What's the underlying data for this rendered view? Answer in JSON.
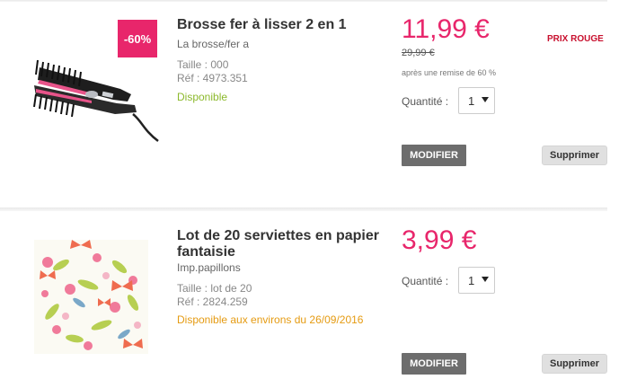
{
  "items": [
    {
      "badge": "-60%",
      "title": "Brosse fer à lisser 2 en 1",
      "subtitle": "La brosse/fer a",
      "size": "Taille : 000",
      "ref": "Réf : 4973.351",
      "availability": "Disponible",
      "price": "11,99 €",
      "old_price": "29,99 €",
      "discount_note": "après une remise de 60 %",
      "promo_label": "PRIX ROUGE",
      "quantity_label": "Quantité :",
      "quantity": "1",
      "modify_label": "MODIFIER",
      "delete_label": "Supprimer",
      "image_icon": "hair-straightener-brush-icon"
    },
    {
      "title": "Lot de 20 serviettes en papier fantaisie",
      "subtitle": "Imp.papillons",
      "size": "Taille : lot de 20",
      "ref": "Réf : 2824.259",
      "availability": "Disponible aux environs du 26/09/2016",
      "price": "3,99 €",
      "quantity_label": "Quantité :",
      "quantity": "1",
      "modify_label": "MODIFIER",
      "delete_label": "Supprimer",
      "image_icon": "butterfly-napkin-icon"
    }
  ],
  "colors": {
    "price": "#e8266b",
    "badge": "#e8266b",
    "available": "#8cb92c",
    "available_later": "#e59b12",
    "promo": "#c8102e"
  }
}
